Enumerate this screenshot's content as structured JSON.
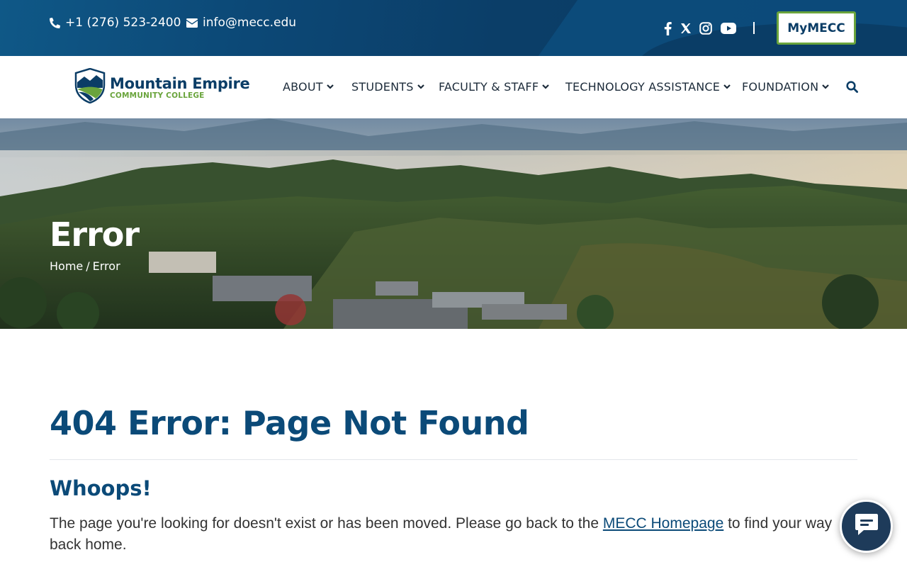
{
  "topbar": {
    "phone": "+1 (276) 523-2400",
    "email": "info@mecc.edu",
    "social": [
      "facebook-icon",
      "x-icon",
      "instagram-icon",
      "youtube-icon"
    ],
    "portal_button": "MyMECC"
  },
  "logo": {
    "title": "Mountain Empire",
    "subtitle": "COMMUNITY COLLEGE"
  },
  "nav": {
    "items": [
      {
        "label": "ABOUT"
      },
      {
        "label": "STUDENTS"
      },
      {
        "label": "FACULTY & STAFF"
      },
      {
        "label": "TECHNOLOGY ASSISTANCE"
      },
      {
        "label": "FOUNDATION"
      }
    ]
  },
  "hero": {
    "title": "Error",
    "breadcrumb": {
      "home": "Home",
      "separator": "/",
      "current": "Error"
    }
  },
  "content": {
    "heading": "404 Error: Page Not Found",
    "subheading": "Whoops!",
    "text_before": "The page you're looking for doesn't exist or has been moved. Please go back to the ",
    "link": "MECC Homepage",
    "text_after": " to find your way back home."
  },
  "colors": {
    "brand_blue": "#0b3d66",
    "brand_green": "#6aa43c",
    "heading_blue": "#0b4a78"
  }
}
